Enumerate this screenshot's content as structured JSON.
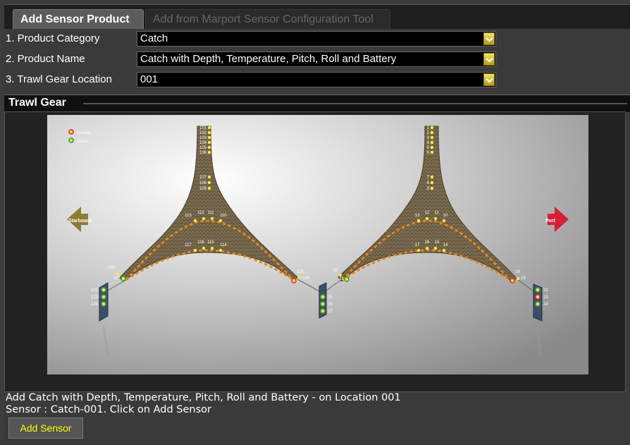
{
  "tabs": {
    "active": "Add Sensor Product",
    "inactive": "Add from Marport Sensor Configuration Tool"
  },
  "form": {
    "category": {
      "label": "1. Product Category",
      "value": "Catch"
    },
    "name": {
      "label": "2. Product Name",
      "value": "Catch with Depth, Temperature, Pitch, Roll and Battery"
    },
    "location": {
      "label": "3. Trawl Gear Location",
      "value": "001"
    }
  },
  "panel": {
    "title": "Trawl Gear"
  },
  "diagram": {
    "legend": {
      "master": "master",
      "slave": "slave"
    },
    "starboard_label": "Starboard",
    "port_label": "Port",
    "left_top_labels": [
      "101",
      "102",
      "103",
      "104",
      "105",
      "106"
    ],
    "left_mid_labels": [
      "107",
      "108",
      "109"
    ],
    "left_upper_row": [
      "113",
      "112",
      "111",
      "110"
    ],
    "left_lower_row": [
      "117",
      "116",
      "115",
      "114"
    ],
    "left_wing": [
      "120",
      "121"
    ],
    "left_door": [
      "122",
      "123",
      "124"
    ],
    "center_left": [
      "118",
      "119"
    ],
    "center_right": [
      "20",
      "21"
    ],
    "center_door": [
      "25",
      "26",
      "27"
    ],
    "right_top_labels": [
      "1",
      "2",
      "3",
      "4",
      "5",
      "6"
    ],
    "right_mid_labels": [
      "7",
      "8",
      "9"
    ],
    "right_upper_row": [
      "13",
      "12",
      "11",
      "10"
    ],
    "right_lower_row": [
      "17",
      "16",
      "15",
      "14"
    ],
    "right_wing": [
      "18",
      "19"
    ],
    "right_door": [
      "22",
      "23",
      "24"
    ]
  },
  "status": {
    "line1": "Add Catch with Depth, Temperature, Pitch, Roll and Battery - on Location 001",
    "line2": "Sensor : Catch-001. Click on Add Sensor"
  },
  "add_button": "Add Sensor"
}
